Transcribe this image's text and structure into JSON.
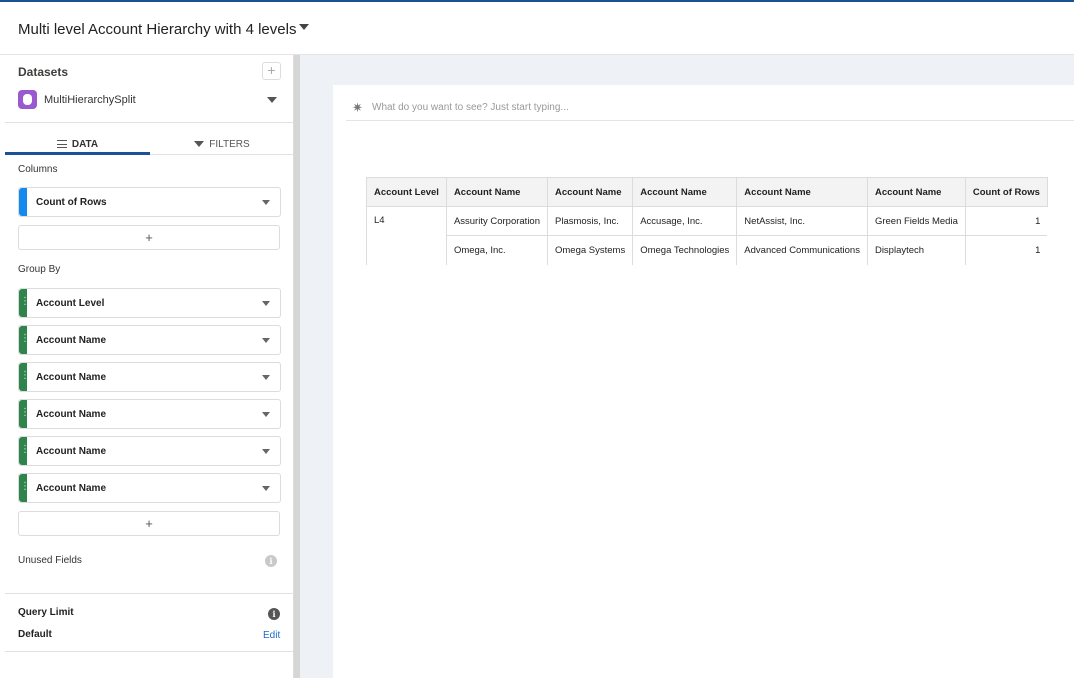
{
  "header": {
    "title": "Multi level Account Hierarchy with 4 levels"
  },
  "sidebar": {
    "datasets_heading": "Datasets",
    "add_symbol": "+",
    "dataset_name": "MultiHierarchySplit",
    "tabs": {
      "data": "DATA",
      "filters": "FILTERS"
    },
    "columns_label": "Columns",
    "columns": [
      {
        "label": "Count of Rows",
        "color": "#1589ee"
      }
    ],
    "add_column_symbol": "+",
    "group_by_label": "Group By",
    "group_by": [
      {
        "label": "Account Level"
      },
      {
        "label": "Account Name"
      },
      {
        "label": "Account Name"
      },
      {
        "label": "Account Name"
      },
      {
        "label": "Account Name"
      },
      {
        "label": "Account Name"
      }
    ],
    "group_color": "#2e844a",
    "add_group_symbol": "+",
    "unused_fields_label": "Unused Fields",
    "info_symbol": "i",
    "query_limit_label": "Query Limit",
    "query_limit_value": "Default",
    "edit_label": "Edit"
  },
  "search": {
    "placeholder": "What do you want to see? Just start typing..."
  },
  "table": {
    "headers": [
      "Account Level",
      "Account Name",
      "Account Name",
      "Account Name",
      "Account Name",
      "Account Name",
      "Count of Rows"
    ],
    "rows": [
      {
        "level": "L4",
        "names": [
          "Assurity Corporation",
          "Plasmosis, Inc.",
          "Accusage, Inc.",
          "NetAssist, Inc.",
          "Green Fields Media"
        ],
        "count": "1"
      },
      {
        "level": "",
        "names": [
          "Omega, Inc.",
          "Omega Systems",
          "Omega Technologies",
          "Advanced Communications",
          "Displaytech"
        ],
        "count": "1"
      }
    ]
  },
  "colors": {
    "accent": "#1b5297",
    "dataset_icon": "#9b59d0",
    "link": "#1b6ac9"
  }
}
